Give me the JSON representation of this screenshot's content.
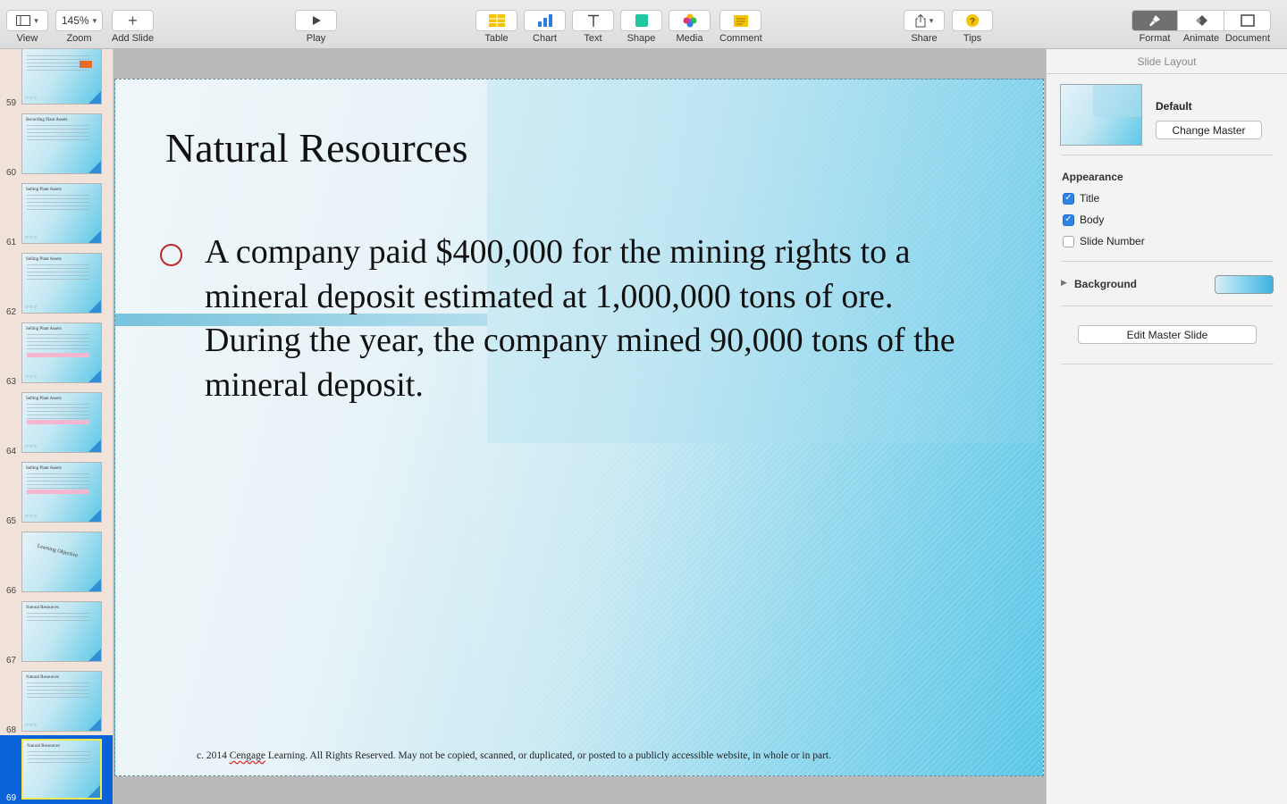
{
  "toolbar": {
    "view_label": "View",
    "zoom_value": "145%",
    "zoom_label": "Zoom",
    "add_slide_label": "Add Slide",
    "play_label": "Play",
    "table_label": "Table",
    "chart_label": "Chart",
    "text_label": "Text",
    "shape_label": "Shape",
    "media_label": "Media",
    "comment_label": "Comment",
    "share_label": "Share",
    "tips_label": "Tips",
    "format_label": "Format",
    "animate_label": "Animate",
    "document_label": "Document"
  },
  "navigator": {
    "slides": [
      {
        "number": "59",
        "title": ""
      },
      {
        "number": "60",
        "title": "Recording Plant Assets"
      },
      {
        "number": "61",
        "title": "Selling Plant Assets"
      },
      {
        "number": "62",
        "title": "Selling Plant Assets"
      },
      {
        "number": "63",
        "title": "Selling Plant Assets"
      },
      {
        "number": "64",
        "title": "Selling Plant Assets"
      },
      {
        "number": "65",
        "title": "Selling Plant Assets"
      },
      {
        "number": "66",
        "title": "Learning Objective"
      },
      {
        "number": "67",
        "title": "Natural Resources"
      },
      {
        "number": "68",
        "title": "Natural Resources"
      },
      {
        "number": "69",
        "title": "Natural Resources"
      }
    ],
    "selected": "69"
  },
  "slide": {
    "title": "Natural Resources",
    "bullet": "A company paid $400,000 for the mining rights to a mineral deposit estimated at 1,000,000 tons of ore. During the year, the company mined 90,000 tons of the mineral deposit.",
    "footer_prefix": "c. 2014 ",
    "footer_brand": "Cengage",
    "footer_rest": " Learning.   All Rights Reserved.  May not be copied, scanned, or duplicated, or posted to a publicly accessible website, in whole or in part."
  },
  "inspector": {
    "header": "Slide Layout",
    "master_name": "Default",
    "change_master_label": "Change Master",
    "appearance_title": "Appearance",
    "title_option": {
      "label": "Title",
      "checked": true
    },
    "body_option": {
      "label": "Body",
      "checked": true
    },
    "slide_number_option": {
      "label": "Slide Number",
      "checked": false
    },
    "background_label": "Background",
    "edit_master_label": "Edit Master Slide"
  },
  "colors": {
    "selection": "#0a62d8",
    "checkbox": "#2a83e8",
    "bullet": "#c0282e",
    "slide_accent": "#58c6e6"
  }
}
